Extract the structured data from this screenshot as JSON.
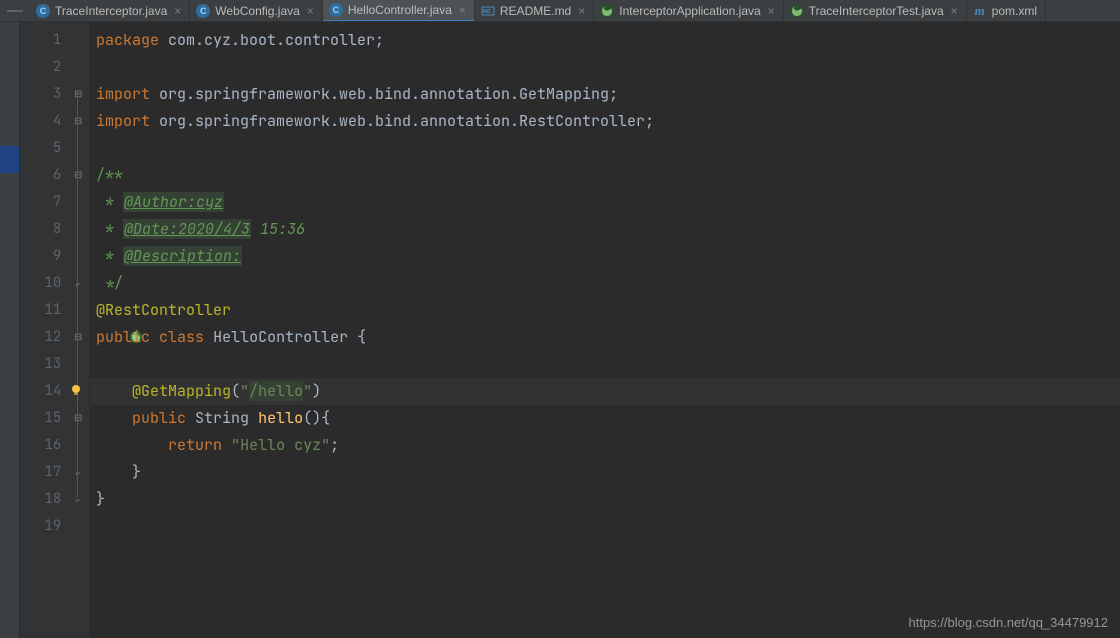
{
  "tabs": [
    {
      "label": "TraceInterceptor.java"
    },
    {
      "label": "WebConfig.java"
    },
    {
      "label": "HelloController.java",
      "active": true
    },
    {
      "label": "README.md"
    },
    {
      "label": "InterceptorApplication.java"
    },
    {
      "label": "TraceInterceptorTest.java"
    },
    {
      "label": "pom.xml"
    }
  ],
  "lines": [
    "1",
    "2",
    "3",
    "4",
    "5",
    "6",
    "7",
    "8",
    "9",
    "10",
    "11",
    "12",
    "13",
    "14",
    "15",
    "16",
    "17",
    "18",
    "19"
  ],
  "code": {
    "kw": {
      "package": "package",
      "import": "import",
      "public": "public",
      "class": "class",
      "return": "return"
    },
    "package": "com.cyz.boot.controller",
    "imports": [
      {
        "pkg": "org.springframework.web.bind.annotation.",
        "cls": "GetMapping"
      },
      {
        "pkg": "org.springframework.web.bind.annotation.",
        "cls": "RestController"
      }
    ],
    "doc": {
      "open": "/**",
      "star": " *",
      "author": "@Author:cyz",
      "date": "@Date:2020/4/3",
      "time": "15:36",
      "desc": "@Description:",
      "close": " */"
    },
    "ann": {
      "restController": "@RestController",
      "getMapping": "@GetMapping"
    },
    "className": "HelloController",
    "mapping": "/hello",
    "retType": "String",
    "methodName": "hello",
    "retValue": "Hello cyz"
  },
  "watermark": "https://blog.csdn.net/qq_34479912"
}
